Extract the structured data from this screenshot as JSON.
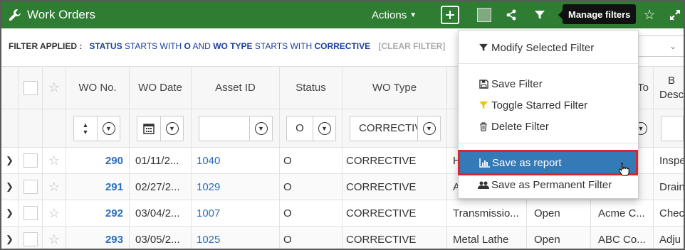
{
  "header": {
    "title": "Work Orders",
    "actions_label": "Actions",
    "tooltip": "Manage filters"
  },
  "filter_bar": {
    "applied_label": "FILTER APPLIED :",
    "f1_field": "STATUS",
    "f1_op": "STARTS WITH",
    "f1_value": "O",
    "joiner": "AND",
    "f2_field": "WO TYPE",
    "f2_op": "STARTS WITH",
    "f2_value": "CORRECTIVE",
    "clear_label": "[CLEAR FILTER]"
  },
  "columns": {
    "wo_no": "WO No.",
    "wo_date": "WO Date",
    "asset_id": "Asset ID",
    "status": "Status",
    "wo_type": "WO Type",
    "assigned_to_partial": "To",
    "desc_partial_1": "B",
    "desc_partial_2": "Desc"
  },
  "filters": {
    "status_value": "O",
    "wo_type_value": "CORRECTIVE"
  },
  "rows": [
    {
      "wo_no": "290",
      "wo_date": "01/11/2...",
      "asset_id": "1040",
      "status": "O",
      "wo_type": "CORRECTIVE",
      "asset_name": "H",
      "desc": "Inspe"
    },
    {
      "wo_no": "291",
      "wo_date": "02/27/2...",
      "asset_id": "1029",
      "status": "O",
      "wo_type": "CORRECTIVE",
      "asset_name": "A",
      "desc": "Drain"
    },
    {
      "wo_no": "292",
      "wo_date": "03/04/2...",
      "asset_id": "1007",
      "status": "O",
      "wo_type": "CORRECTIVE",
      "asset_name": "Transmissio...",
      "wo_status": "Open",
      "assigned": "Acme C...",
      "desc": "Chec"
    },
    {
      "wo_no": "293",
      "wo_date": "03/05/2...",
      "asset_id": "1025",
      "status": "O",
      "wo_type": "CORRECTIVE",
      "asset_name": "Metal Lathe",
      "wo_status": "Open",
      "assigned": "ABC Co...",
      "desc": "Adju"
    }
  ],
  "menu": {
    "modify": "Modify Selected Filter",
    "save": "Save Filter",
    "toggle_star": "Toggle Starred Filter",
    "delete": "Delete Filter",
    "save_report": "Save as report",
    "save_permanent": "Save as Permanent Filter"
  },
  "colors": {
    "header_bg": "#2e7d32",
    "highlight": "#337ab7",
    "callout": "#d9262c",
    "link": "#2a6ebb"
  },
  "icons": [
    "wrench-icon",
    "chevron-down-icon",
    "plus-icon",
    "share-icon",
    "filter-icon",
    "star-icon",
    "expand-icon",
    "calendar-icon",
    "sort-icon",
    "chart-icon",
    "save-icon",
    "trash-icon",
    "users-icon",
    "hand-cursor-icon"
  ]
}
